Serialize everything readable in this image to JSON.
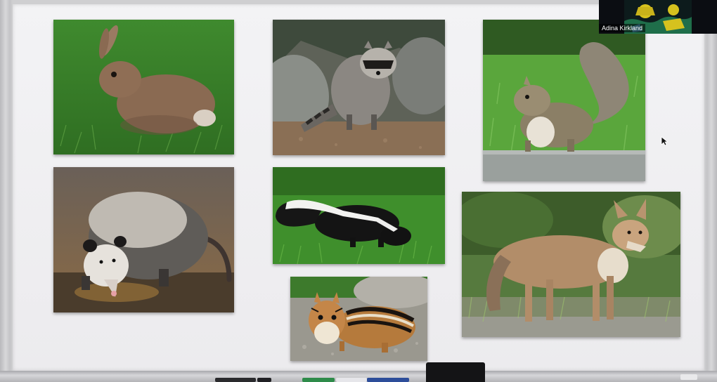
{
  "participant": {
    "name": "Adina Kirkland"
  },
  "photos": [
    {
      "animal": "rabbit",
      "icon": "rabbit-photo"
    },
    {
      "animal": "raccoon",
      "icon": "raccoon-photo"
    },
    {
      "animal": "squirrel",
      "icon": "squirrel-photo"
    },
    {
      "animal": "opossum",
      "icon": "opossum-photo"
    },
    {
      "animal": "skunk",
      "icon": "skunk-photo"
    },
    {
      "animal": "chipmunk",
      "icon": "chipmunk-photo"
    },
    {
      "animal": "coyote",
      "icon": "coyote-photo"
    }
  ],
  "colors": {
    "board": "#efeef1",
    "frame": "#c4c4c7",
    "grass": "#4f9b3a",
    "video_bg": "#0b0d12",
    "video_accent": "#d6c21e"
  }
}
